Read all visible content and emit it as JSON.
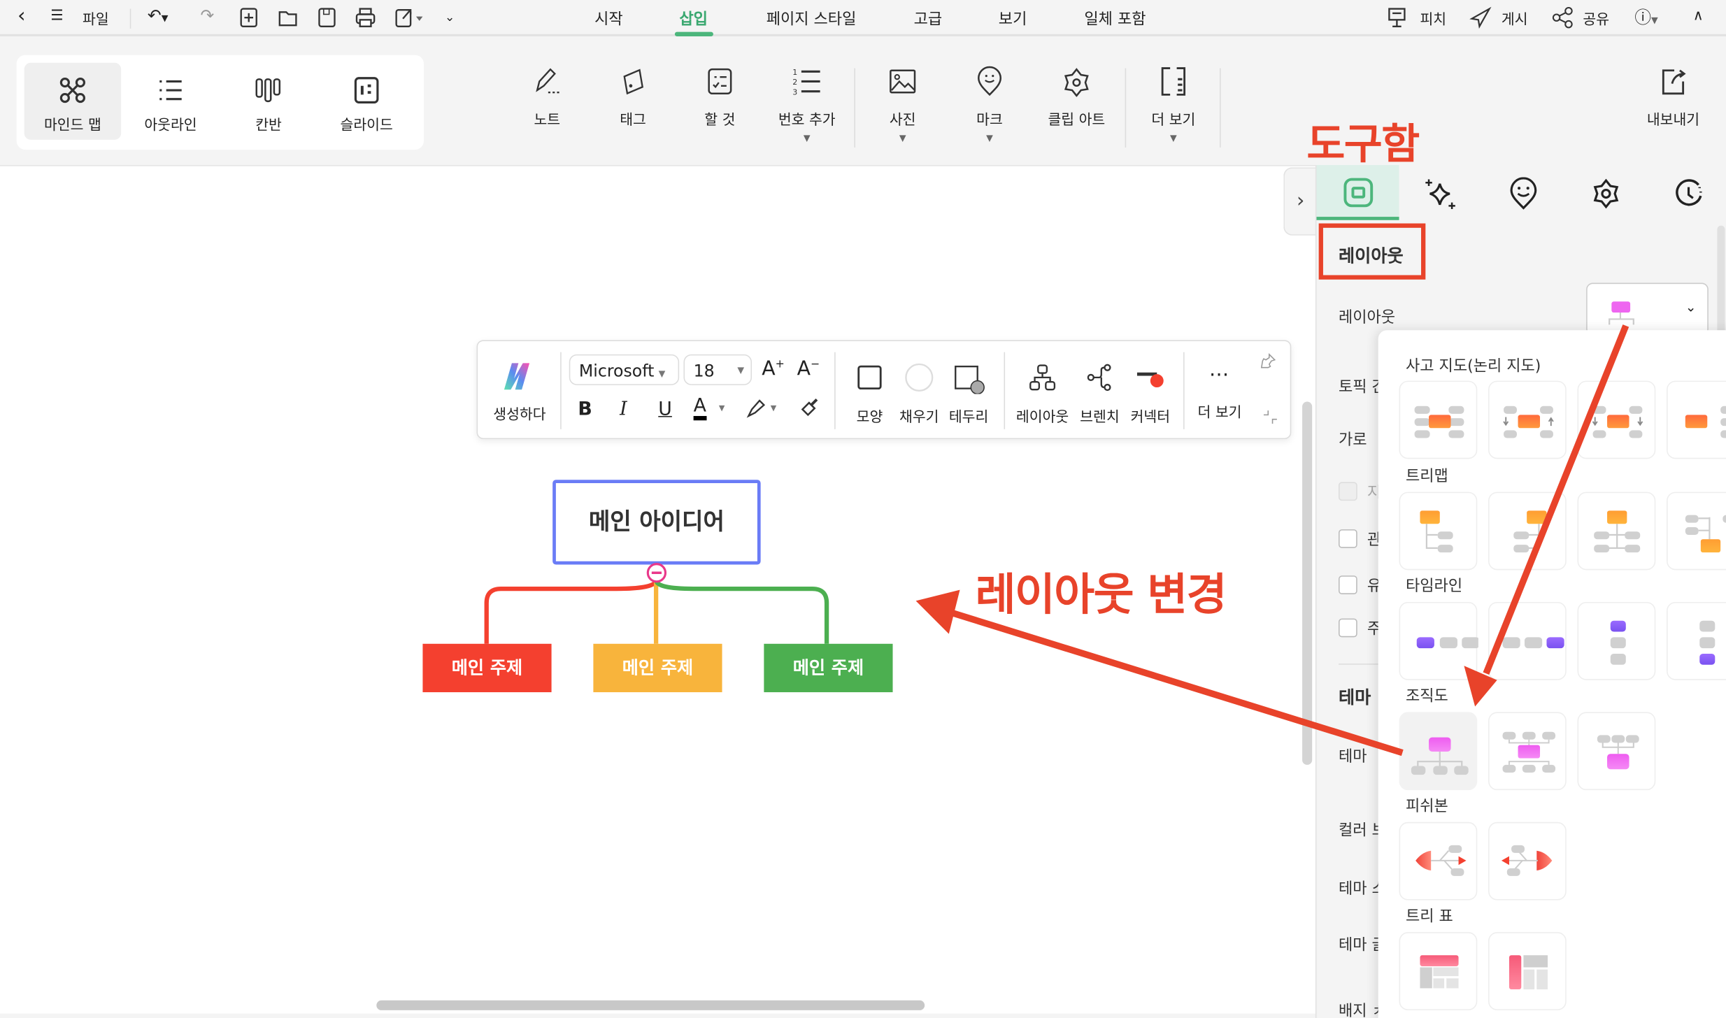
{
  "topbar": {
    "file": "파일",
    "menu_tabs": [
      "시작",
      "삽입",
      "페이지 스타일",
      "고급",
      "보기",
      "일체 포함"
    ],
    "active_tab": "삽입",
    "right": {
      "pitch": "피치",
      "publish": "게시",
      "share": "공유"
    }
  },
  "ribbon": {
    "modes": [
      "마인드 맵",
      "아웃라인",
      "칸반",
      "슬라이드"
    ],
    "selected_mode": "마인드 맵",
    "tools": {
      "note": "노트",
      "tag": "태그",
      "todo": "할 것",
      "numbering": "번호 추가",
      "photo": "사진",
      "mark": "마크",
      "clipart": "클립 아트",
      "more": "더 보기"
    },
    "export": "내보내기"
  },
  "float_toolbar": {
    "generate": "생성하다",
    "font": "Microsoft",
    "size": "18",
    "bold": "B",
    "italic": "I",
    "underline": "U",
    "font_color": "A",
    "grow": "A",
    "shrink": "A",
    "shape": "모양",
    "fill": "채우기",
    "border": "테두리",
    "layout": "레이아웃",
    "branch": "브렌치",
    "connector": "커넥터",
    "more": "더 보기"
  },
  "mindmap": {
    "central": "메인 아이디어",
    "topics": [
      {
        "label": "메인 주제",
        "color": "#f4402f"
      },
      {
        "label": "메인 주제",
        "color": "#f8b43c"
      },
      {
        "label": "메인 주제",
        "color": "#4caf50"
      }
    ],
    "central_border": "#6a7cf6"
  },
  "annotations": {
    "toolbox": "도구함",
    "change_layout": "레이아웃 변경",
    "color": "#e8432a"
  },
  "panel": {
    "section_title": "레이아웃",
    "labels": {
      "layout": "레이아웃",
      "topic_gap": "토픽 간",
      "horizontal": "가로",
      "cb1": "지",
      "cb2": "관",
      "cb3": "유",
      "cb4": "주",
      "theme_header": "테마",
      "theme": "테마",
      "color": "컬러 브",
      "theme_style": "테마 스",
      "theme_font": "테마 글",
      "badge": "배지 ㅊ"
    }
  },
  "layout_popup": {
    "sections": [
      "사고 지도(논리 지도)",
      "트리맵",
      "타임라인",
      "조직도",
      "피쉬본",
      "트리 표"
    ],
    "selected": "조직도 1"
  },
  "accent": "#4cb67c"
}
